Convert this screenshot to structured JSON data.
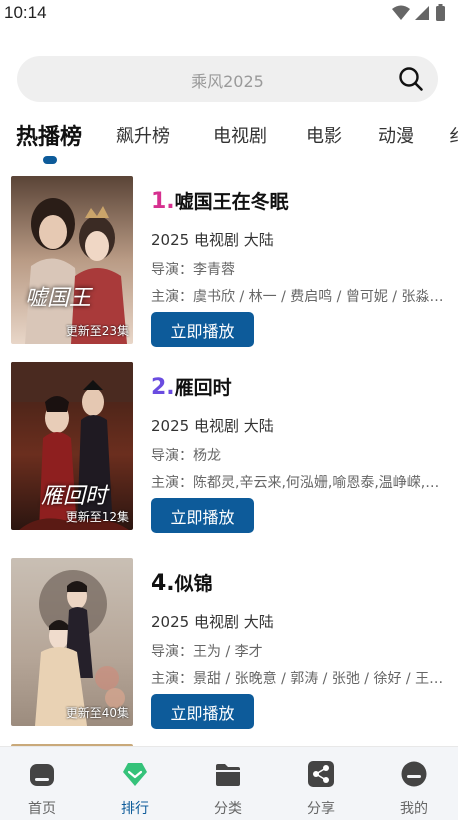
{
  "status": {
    "time": "10:14"
  },
  "search": {
    "placeholder": "乘风2025"
  },
  "tabs": [
    {
      "label": "热播榜"
    },
    {
      "label": "飙升榜"
    },
    {
      "label": "电视剧"
    },
    {
      "label": "电影"
    },
    {
      "label": "动漫"
    },
    {
      "label": "纟"
    }
  ],
  "items": [
    {
      "rank": "1.",
      "rank_color": "#d6308f",
      "title": "嘘国王在冬眠",
      "meta": "2025  电视剧  大陆",
      "director": "导演：李青蓉",
      "cast": "主演：虞书欣 / 林一 / 费启鸣 / 曾可妮 / 张淼怡 / 赵昭仪",
      "update": "更新至23集",
      "play_label": "立即播放"
    },
    {
      "rank": "2.",
      "rank_color": "#6a4ce0",
      "title": "雁回时",
      "meta": "2025  电视剧  大陆",
      "director": "导演：杨龙",
      "cast": "主演：陈都灵,辛云来,何泓姗,喻恩泰,温峥嵘,何中华",
      "update": "更新至12集",
      "play_label": "立即播放"
    },
    {
      "rank": "4.",
      "rank_color": "#111111",
      "title": "似锦",
      "meta": "2025  电视剧  大陆",
      "director": "导演：王为 / 李才",
      "cast": "主演：景甜 / 张晚意 / 郭涛 / 张弛 / 徐好 / 王一菲",
      "update": "更新至40集",
      "play_label": "立即播放"
    }
  ],
  "nav": [
    {
      "label": "首页",
      "icon": "home-icon"
    },
    {
      "label": "排行",
      "icon": "ranking-icon"
    },
    {
      "label": "分类",
      "icon": "folder-icon"
    },
    {
      "label": "分享",
      "icon": "share-icon"
    },
    {
      "label": "我的",
      "icon": "profile-icon"
    }
  ],
  "colors": {
    "accent": "#0d5b9a",
    "ranking_active": "#35c27a"
  }
}
